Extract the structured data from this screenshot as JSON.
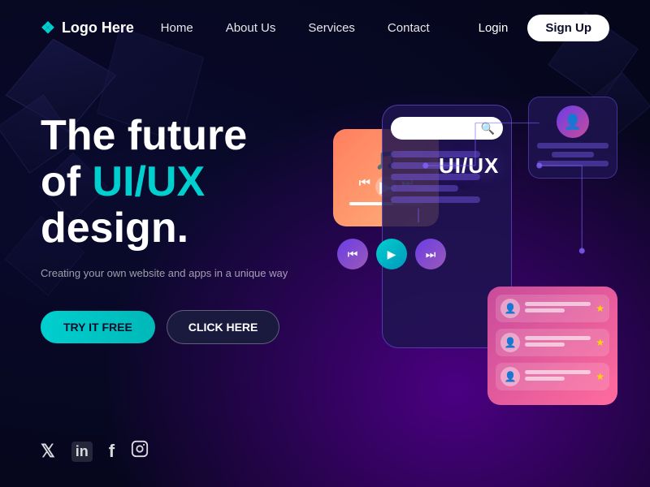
{
  "logo": {
    "icon": "❖",
    "text": "Logo Here"
  },
  "nav": {
    "links": [
      {
        "id": "home",
        "label": "Home"
      },
      {
        "id": "about",
        "label": "About Us"
      },
      {
        "id": "services",
        "label": "Services"
      },
      {
        "id": "contact",
        "label": "Contact"
      }
    ],
    "login": "Login",
    "signup": "Sign Up"
  },
  "hero": {
    "title_line1": "The future",
    "title_line2": "of ",
    "title_highlight": "UI/UX",
    "title_line3": "design.",
    "subtitle": "Creating your own website and apps in a unique way",
    "btn_try": "TRY IT FREE",
    "btn_click": "CLICK HERE"
  },
  "social": {
    "twitter": "𝕏",
    "linkedin": "in",
    "facebook": "f",
    "instagram": "📷"
  },
  "mockup": {
    "uiux_label": "UI/UX",
    "search_placeholder": ""
  },
  "colors": {
    "accent_cyan": "#00cfcf",
    "accent_purple": "#6a3de8",
    "accent_pink": "#c84b9b"
  }
}
